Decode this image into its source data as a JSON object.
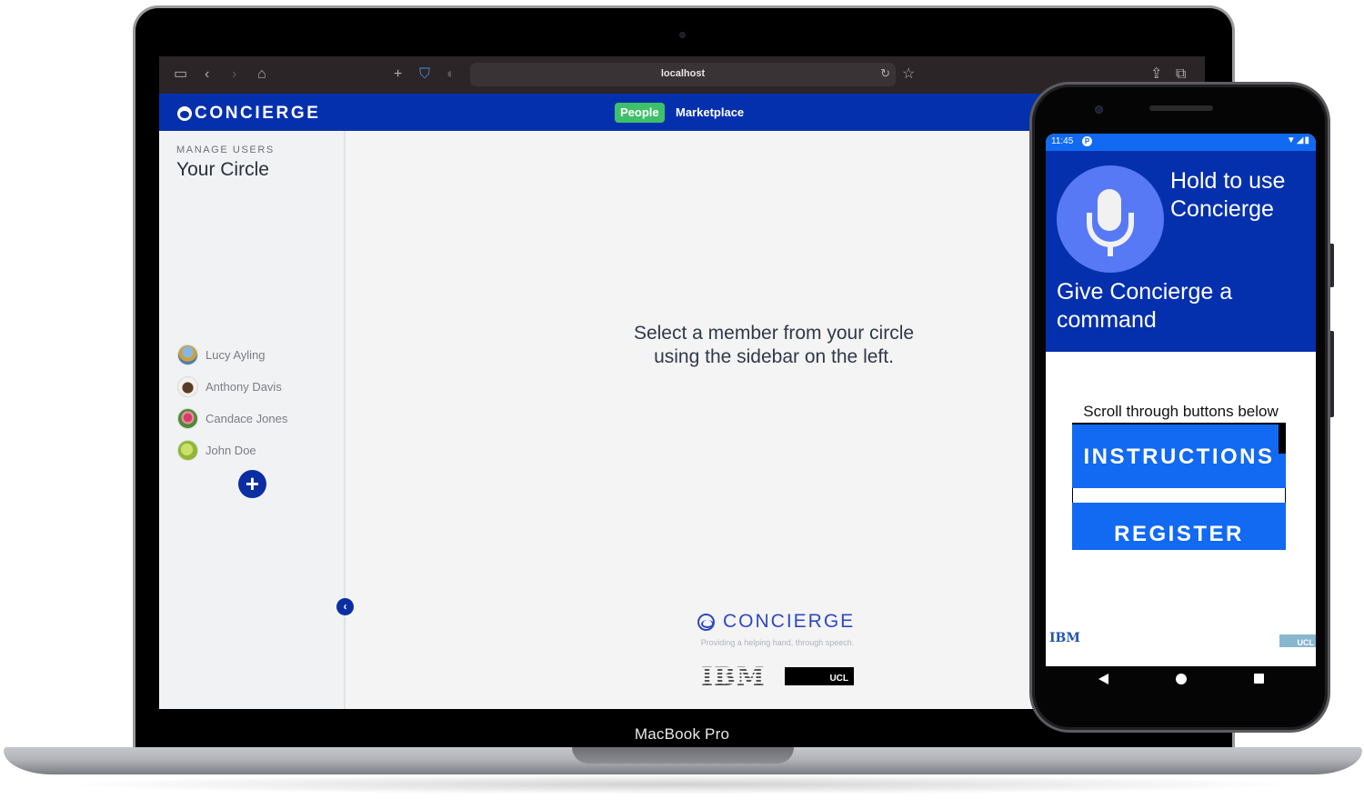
{
  "laptop": {
    "model_label": "MacBook Pro",
    "browser": {
      "url": "localhost",
      "icons": [
        "sidebar-toggle-icon",
        "back-icon",
        "forward-icon",
        "home-icon",
        "new-tab-icon",
        "shield-icon",
        "reader-icon",
        "reload-icon",
        "bookmark-star-icon",
        "share-icon",
        "tabs-icon"
      ]
    },
    "app": {
      "brand": "CONCIERGE",
      "brand_color": "#0530ad",
      "nav_tabs": [
        {
          "label": "People",
          "active": true,
          "color": "#3ec06a"
        },
        {
          "label": "Marketplace",
          "active": false
        }
      ],
      "sidebar": {
        "eyebrow": "MANAGE USERS",
        "title": "Your Circle",
        "members": [
          {
            "name": "Lucy Ayling",
            "avatar": "landscape-photo"
          },
          {
            "name": "Anthony Davis",
            "avatar": "dog-photo"
          },
          {
            "name": "Candace Jones",
            "avatar": "tulip-photo"
          },
          {
            "name": "John Doe",
            "avatar": "apple-photo"
          }
        ],
        "add_button_icon": "plus-icon",
        "collapse_button_icon": "chevron-left-icon"
      },
      "main": {
        "empty_message": "Select a member from your circle using the sidebar on the left."
      },
      "footer": {
        "brand": "CONCIERGE",
        "tagline": "Providing a helping hand, through speech.",
        "partner_logos": [
          "IBM",
          "UCL"
        ]
      }
    }
  },
  "phone": {
    "status_bar": {
      "time": "11:45",
      "app_icon": "P",
      "system_icons": "▼◢▮"
    },
    "voice": {
      "mic_icon": "microphone-icon",
      "hold_text": "Hold to use Concierge",
      "command_text": "Give Concierge a command"
    },
    "scroll_hint": "Scroll through buttons below",
    "buttons": [
      {
        "label": "INSTRUCTIONS"
      },
      {
        "label": "REGISTER"
      }
    ],
    "logos": [
      "IBM",
      "UCL"
    ],
    "nav": [
      "back",
      "home",
      "recents"
    ]
  }
}
